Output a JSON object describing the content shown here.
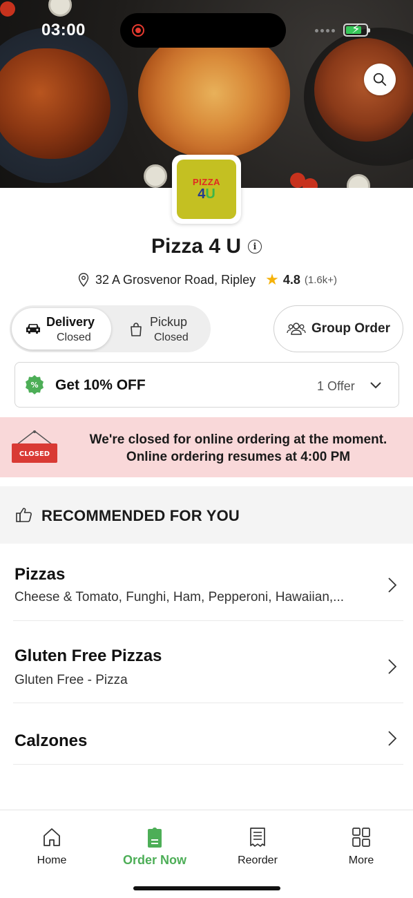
{
  "status_bar": {
    "time": "03:00"
  },
  "restaurant": {
    "logo_line1": "PIZZA",
    "logo_line2_num": "4",
    "logo_line2_letter": "U",
    "name": "Pizza 4 U",
    "address": "32 A Grosvenor Road, Ripley",
    "rating": "4.8",
    "rating_count": "(1.6k+)"
  },
  "modes": {
    "delivery_label": "Delivery",
    "delivery_status": "Closed",
    "pickup_label": "Pickup",
    "pickup_status": "Closed",
    "selected": "delivery"
  },
  "group_order_label": "Group Order",
  "offer": {
    "title": "Get 10% OFF",
    "count": "1 Offer"
  },
  "closed_banner": {
    "sign_text": "CLOSED",
    "line1": "We're closed for online ordering at the moment.",
    "line2": "Online ordering resumes at 4:00 PM"
  },
  "recommended": {
    "title": "RECOMMENDED FOR YOU",
    "categories": [
      {
        "title": "Pizzas",
        "desc": "Cheese & Tomato, Funghi, Ham, Pepperoni, Hawaiian,..."
      },
      {
        "title": "Gluten Free Pizzas",
        "desc": "Gluten Free - Pizza"
      },
      {
        "title": "Calzones",
        "desc": ""
      }
    ]
  },
  "bottom_nav": {
    "items": [
      {
        "label": "Home",
        "icon": "home-icon"
      },
      {
        "label": "Order Now",
        "icon": "order-icon"
      },
      {
        "label": "Reorder",
        "icon": "receipt-icon"
      },
      {
        "label": "More",
        "icon": "grid-icon"
      }
    ],
    "active_index": 1
  },
  "colors": {
    "accent_green": "#4dae57",
    "closed_banner_bg": "#f9d8d9",
    "closed_sign_red": "#d93a34",
    "star_gold": "#f5b20a",
    "logo_bg": "#c4c022"
  }
}
